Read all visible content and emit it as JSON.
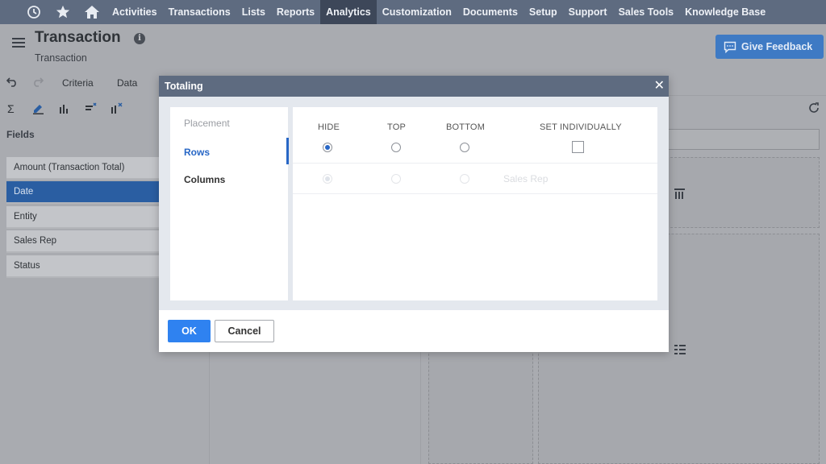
{
  "nav": {
    "items": [
      {
        "label": "Activities",
        "active": false
      },
      {
        "label": "Transactions",
        "active": false
      },
      {
        "label": "Lists",
        "active": false
      },
      {
        "label": "Reports",
        "active": false
      },
      {
        "label": "Analytics",
        "active": true
      },
      {
        "label": "Customization",
        "active": false
      },
      {
        "label": "Documents",
        "active": false
      },
      {
        "label": "Setup",
        "active": false
      },
      {
        "label": "Support",
        "active": false
      },
      {
        "label": "Sales Tools",
        "active": false
      },
      {
        "label": "Knowledge Base",
        "active": false
      }
    ]
  },
  "page": {
    "title": "Transaction",
    "subtitle": "Transaction",
    "feedback_label": "Give Feedback"
  },
  "tabs": {
    "criteria": "Criteria",
    "data": "Data"
  },
  "fields": {
    "label": "Fields",
    "items": [
      {
        "label": "Amount (Transaction Total)",
        "selected": false
      },
      {
        "label": "Date",
        "selected": true
      },
      {
        "label": "Entity",
        "selected": false
      },
      {
        "label": "Sales Rep",
        "selected": false
      },
      {
        "label": "Status",
        "selected": false
      }
    ]
  },
  "dialog": {
    "title": "Totaling",
    "side_nav": {
      "header": "Placement",
      "rows": "Rows",
      "columns": "Columns"
    },
    "columns": {
      "hide": "HIDE",
      "top": "TOP",
      "bottom": "BOTTOM",
      "set_individually": "SET INDIVIDUALLY"
    },
    "faded_row_label": "Sales Rep",
    "ok_label": "OK",
    "cancel_label": "Cancel"
  },
  "colors": {
    "nav_bg": "#5e6b80",
    "accent": "#2867c6",
    "ok_button": "#2f82f0",
    "selected_field": "#2a5ea2"
  }
}
